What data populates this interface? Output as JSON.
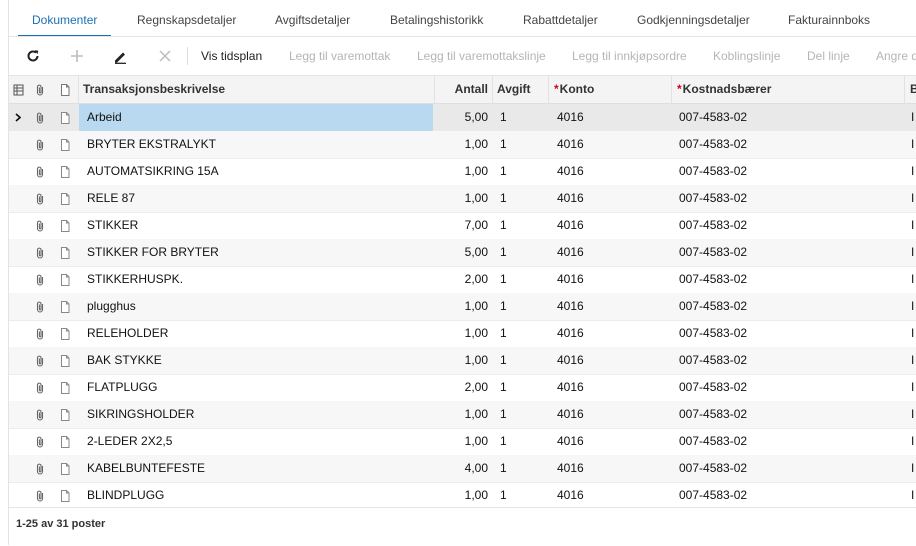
{
  "tabs": [
    {
      "label": "Dokumenter",
      "active": true
    },
    {
      "label": "Regnskapsdetaljer"
    },
    {
      "label": "Avgiftsdetaljer"
    },
    {
      "label": "Betalingshistorikk"
    },
    {
      "label": "Rabattdetaljer"
    },
    {
      "label": "Godkjenningsdetaljer"
    },
    {
      "label": "Fakturainnboks"
    }
  ],
  "toolbar": {
    "icons": [
      "refresh-icon",
      "plus-icon",
      "pencil-icon",
      "close-icon"
    ],
    "vis_tidsplan": "Vis tidsplan",
    "legg_til_varemottak": "Legg til varemottak",
    "legg_til_varemottakslinje": "Legg til varemottakslinje",
    "legg_til_innkjopsordre": "Legg til innkjøpsordre",
    "koblingslinje": "Koblingslinje",
    "del_linje": "Del linje",
    "angre": "Angre d"
  },
  "grid": {
    "columns": {
      "description": "Transaksjonsbeskrivelse",
      "quantity": "Antall",
      "tax": "Avgift",
      "account": "Konto",
      "cost_carrier": "Kostnadsbærer",
      "next": "B",
      "required_marker": "*"
    },
    "rows": [
      {
        "description": "Arbeid",
        "quantity": "5,00",
        "tax": "1",
        "account": "4016",
        "cost_carrier": "007-4583-02",
        "next": "I"
      },
      {
        "description": "BRYTER EKSTRALYKT",
        "quantity": "1,00",
        "tax": "1",
        "account": "4016",
        "cost_carrier": "007-4583-02",
        "next": "I"
      },
      {
        "description": "AUTOMATSIKRING 15A",
        "quantity": "1,00",
        "tax": "1",
        "account": "4016",
        "cost_carrier": "007-4583-02",
        "next": "I"
      },
      {
        "description": "RELE 87",
        "quantity": "1,00",
        "tax": "1",
        "account": "4016",
        "cost_carrier": "007-4583-02",
        "next": "I"
      },
      {
        "description": "STIKKER",
        "quantity": "7,00",
        "tax": "1",
        "account": "4016",
        "cost_carrier": "007-4583-02",
        "next": "I"
      },
      {
        "description": "STIKKER FOR BRYTER",
        "quantity": "5,00",
        "tax": "1",
        "account": "4016",
        "cost_carrier": "007-4583-02",
        "next": "I"
      },
      {
        "description": "STIKKERHUSPK.",
        "quantity": "2,00",
        "tax": "1",
        "account": "4016",
        "cost_carrier": "007-4583-02",
        "next": "I"
      },
      {
        "description": "plugghus",
        "quantity": "1,00",
        "tax": "1",
        "account": "4016",
        "cost_carrier": "007-4583-02",
        "next": "I"
      },
      {
        "description": "RELEHOLDER",
        "quantity": "1,00",
        "tax": "1",
        "account": "4016",
        "cost_carrier": "007-4583-02",
        "next": "I"
      },
      {
        "description": "BAK STYKKE",
        "quantity": "1,00",
        "tax": "1",
        "account": "4016",
        "cost_carrier": "007-4583-02",
        "next": "I"
      },
      {
        "description": "FLATPLUGG",
        "quantity": "2,00",
        "tax": "1",
        "account": "4016",
        "cost_carrier": "007-4583-02",
        "next": "I"
      },
      {
        "description": "SIKRINGSHOLDER",
        "quantity": "1,00",
        "tax": "1",
        "account": "4016",
        "cost_carrier": "007-4583-02",
        "next": "I"
      },
      {
        "description": "2-LEDER 2X2,5",
        "quantity": "1,00",
        "tax": "1",
        "account": "4016",
        "cost_carrier": "007-4583-02",
        "next": "I"
      },
      {
        "description": "KABELBUNTEFESTE",
        "quantity": "4,00",
        "tax": "1",
        "account": "4016",
        "cost_carrier": "007-4583-02",
        "next": "I"
      },
      {
        "description": "BLINDPLUGG",
        "quantity": "1,00",
        "tax": "1",
        "account": "4016",
        "cost_carrier": "007-4583-02",
        "next": "I"
      }
    ]
  },
  "footer": {
    "paging": "1-25 av 31 poster"
  },
  "colors": {
    "accent": "#1a6fb5",
    "selected_cell": "#b9d9f0",
    "required": "#d0021b"
  }
}
